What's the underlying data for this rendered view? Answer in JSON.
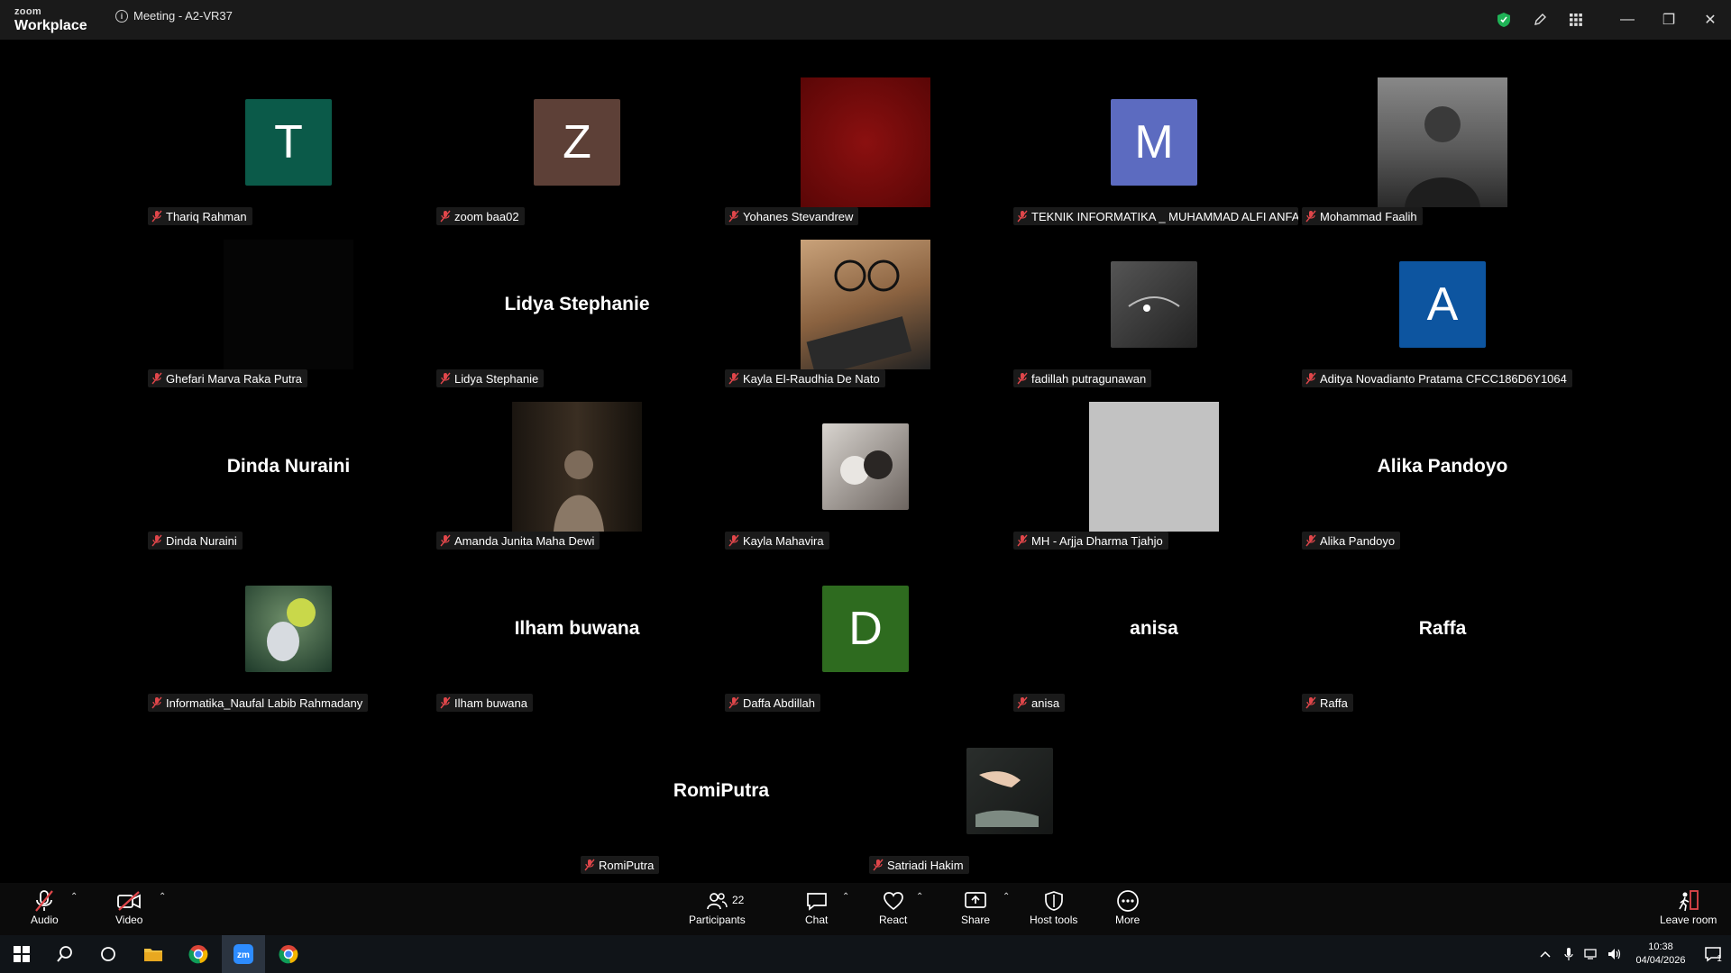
{
  "app": {
    "brand_top": "zoom",
    "brand_bottom": "Workplace"
  },
  "meeting": {
    "title": "Meeting - A2-VR37"
  },
  "tiles": [
    {
      "label": "Thariq Rahman",
      "avatar_letter": "T",
      "avatar_color": "#0b5a49"
    },
    {
      "label": "zoom baa02",
      "avatar_letter": "Z",
      "avatar_color": "#5d4037"
    },
    {
      "label": "Yohanes Stevandrew"
    },
    {
      "label": "TEKNIK INFORMATIKA _ MUHAMMAD ALFI ANFA...",
      "avatar_letter": "M",
      "avatar_color": "#5c6bc0"
    },
    {
      "label": "Mohammad Faalih"
    },
    {
      "label": "Ghefari Marva Raka Putra"
    },
    {
      "label": "Lidya Stephanie",
      "display_name": "Lidya Stephanie"
    },
    {
      "label": "Kayla El-Raudhia De Nato"
    },
    {
      "label": "fadillah putragunawan"
    },
    {
      "label": "Aditya Novadianto Pratama CFCC186D6Y1064",
      "avatar_letter": "A",
      "avatar_color": "#0d55a0"
    },
    {
      "label": "Dinda Nuraini",
      "display_name": "Dinda Nuraini"
    },
    {
      "label": "Amanda Junita Maha Dewi"
    },
    {
      "label": "Kayla Mahavira"
    },
    {
      "label": "MH - Arjja Dharma Tjahjo"
    },
    {
      "label": "Alika Pandoyo",
      "display_name": "Alika Pandoyo"
    },
    {
      "label": "Informatika_Naufal Labib Rahmadany"
    },
    {
      "label": "Ilham buwana",
      "display_name": "Ilham buwana"
    },
    {
      "label": "Daffa Abdillah",
      "avatar_letter": "D",
      "avatar_color": "#2e6b1f"
    },
    {
      "label": "anisa",
      "display_name": "anisa"
    },
    {
      "label": "Raffa",
      "display_name": "Raffa"
    },
    {
      "label": "RomiPutra",
      "display_name": "RomiPutra"
    },
    {
      "label": "Satriadi Hakim"
    }
  ],
  "toolbar": {
    "audio": "Audio",
    "video": "Video",
    "participants": "Participants",
    "participants_count": "22",
    "chat": "Chat",
    "react": "React",
    "share": "Share",
    "host_tools": "Host tools",
    "more": "More",
    "leave": "Leave room"
  },
  "taskbar": {
    "time": "10:38",
    "date": "04/04/2026",
    "notifications": "1"
  },
  "colors": {
    "accent_green": "#1fb256",
    "mic_off": "#e0464a"
  }
}
